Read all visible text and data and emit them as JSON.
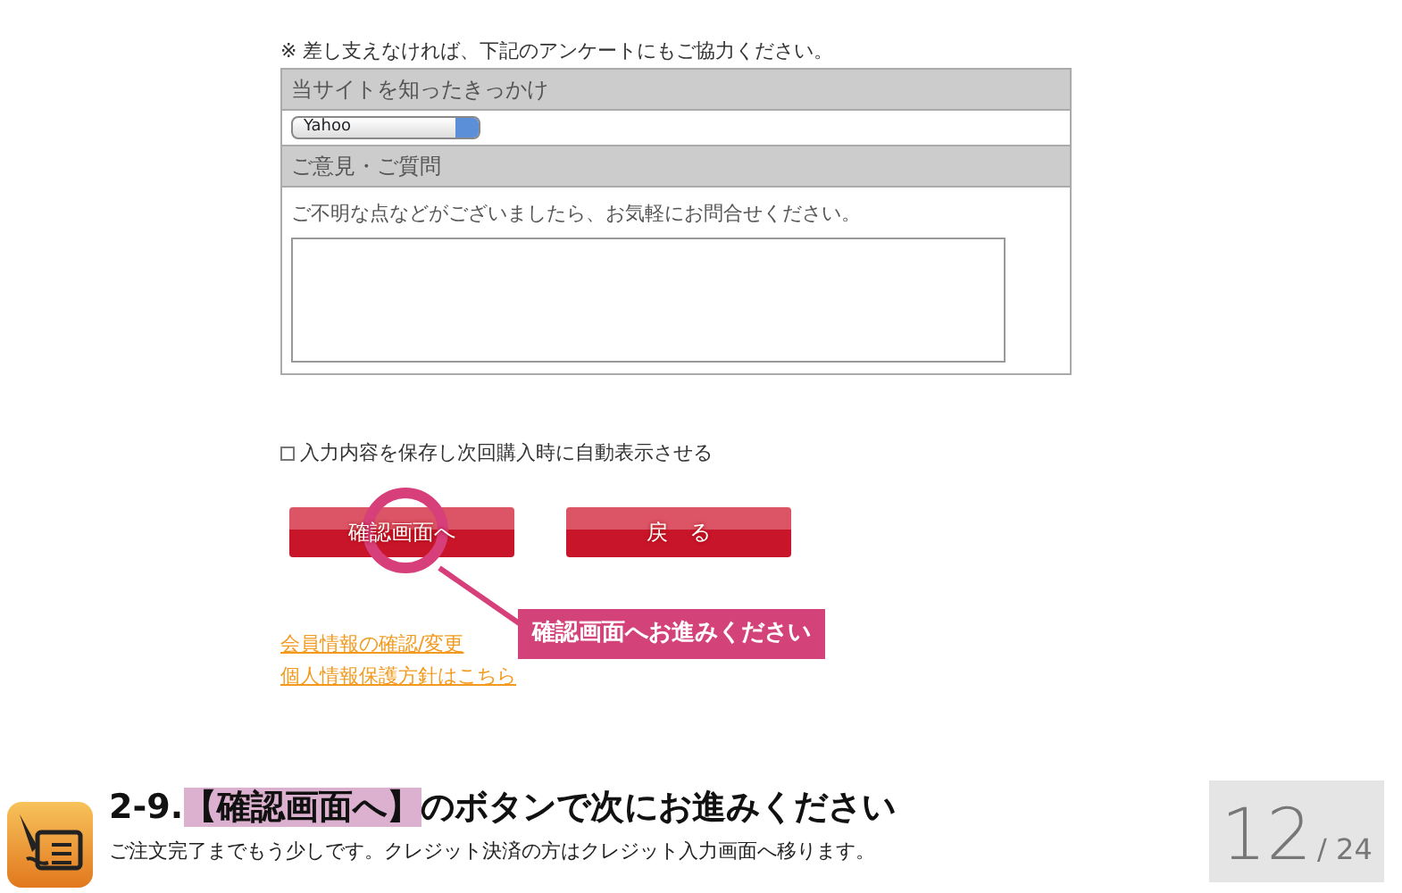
{
  "notice": "※ 差し支えなければ、下記のアンケートにもご協力ください。",
  "survey": [
    {
      "kind": "select",
      "heading": "当サイトを知ったきっかけ",
      "value": "Yahoo"
    },
    {
      "kind": "textarea",
      "heading": "ご意見・ご質問",
      "hint": "ご不明な点などがございましたら、お気軽にお問合せください。"
    }
  ],
  "save_option": {
    "label": "入力内容を保存し次回購入時に自動表示させる",
    "checked": false
  },
  "buttons": [
    "確認画面へ",
    "戻　る"
  ],
  "callout": "確認画面へお進みください",
  "links": [
    "会員情報の確認/変更",
    "個人情報保護方針はこちら"
  ],
  "step": {
    "title": [
      {
        "text": "2-9.",
        "highlighted": false
      },
      {
        "text": "【確認画面へ】",
        "highlighted": true
      },
      {
        "text": "のボタンで次にお進みください",
        "highlighted": false
      }
    ],
    "description": "ご注文完了までもう少しです。クレジット決済の方はクレジット入力画面へ移ります。"
  },
  "page": {
    "current": "12",
    "total": "/ 24"
  }
}
